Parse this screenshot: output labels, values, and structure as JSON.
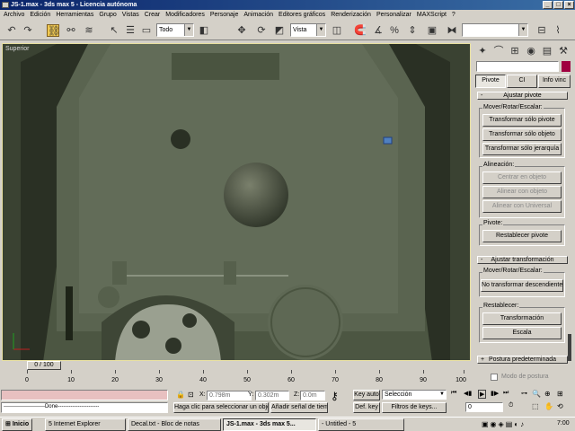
{
  "window": {
    "title": "JS-1.max - 3ds max 5 - Licencia autónoma",
    "min": "_",
    "max": "□",
    "close": "×"
  },
  "menu": [
    "Archivo",
    "Edición",
    "Herramientas",
    "Grupo",
    "Vistas",
    "Crear",
    "Modificadores",
    "Personaje",
    "Animación",
    "Editores gráficos",
    "Renderización",
    "Personalizar",
    "MAXScript",
    "?"
  ],
  "toolbar": {
    "selection_filter": "Todo",
    "reference_coord": "Vista"
  },
  "viewport": {
    "label": "Superior"
  },
  "command_panel": {
    "tabs": [
      "Pivote",
      "CI",
      "Info vinc"
    ],
    "rollout_pivot": "Ajustar pivote",
    "move_group": "Mover/Rotar/Escalar:",
    "move_buttons": [
      "Transformar sólo pivote",
      "Transformar sólo objeto",
      "Transformar sólo jerarquía"
    ],
    "align_group": "Alineación:",
    "align_buttons": [
      "Centrar en objeto",
      "Alinear con objeto",
      "Alinear con Universal"
    ],
    "pivot_group": "Pivote:",
    "reset_pivot": "Restablecer pivote",
    "rollout_transform": "Ajustar transformación",
    "transform_group": "Mover/Rotar/Escalar:",
    "dont_affect": "No transformar descendientes",
    "reset_group": "Restablecer:",
    "reset_buttons": [
      "Transformación",
      "Escala"
    ],
    "rollout_pose": "Postura predeterminada",
    "pose_mode": "Modo de postura"
  },
  "timeline": {
    "frame": "0 / 100",
    "ticks": [
      "0",
      "10",
      "20",
      "30",
      "40",
      "50",
      "60",
      "70",
      "80",
      "90",
      "100"
    ]
  },
  "status": {
    "done": "-----------------------Done-----------------------",
    "x_label": "X:",
    "x": "0.798m",
    "y_label": "Y:",
    "y": "0.302m",
    "z_label": "Z:",
    "z": "0.0m",
    "auto_key": "Key auto",
    "key_mode": "Selección",
    "set_key": "Def. key",
    "key_filters": "Filtros de keys...",
    "prompt": "Haga clic para seleccionar un obje",
    "add_time_tag": "Añadir señal de tiem",
    "current_frame": "0"
  },
  "taskbar": {
    "start": "Inicio",
    "tasks": [
      "5 Internet Explorer",
      "Decal.txt - Bloc de notas",
      "JS-1.max - 3ds max 5...",
      "- Untitled - 5"
    ],
    "clock": "7:00"
  },
  "colors": {
    "title_start": "#0a246a",
    "title_end": "#3a6ea5",
    "viewport_bg": "#4a5440",
    "active_tool": "#f0c850",
    "color_swatch": "#a00040"
  }
}
